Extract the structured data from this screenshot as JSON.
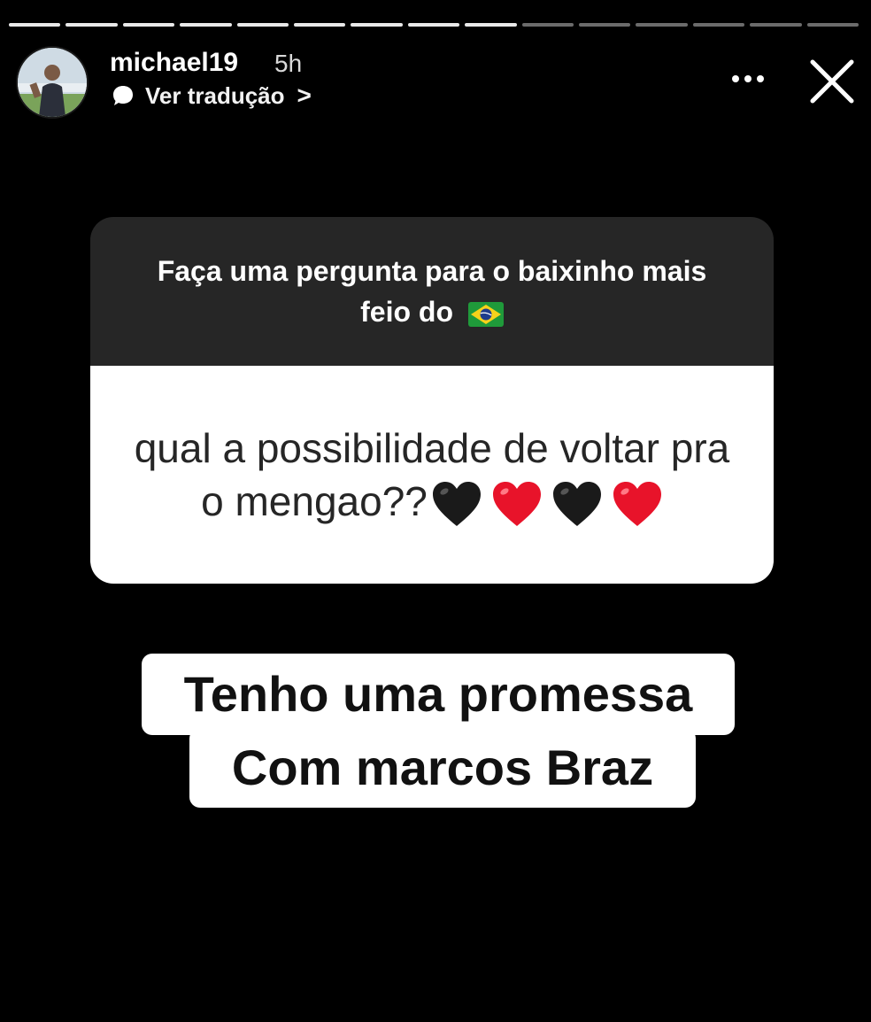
{
  "story": {
    "progress": {
      "segments": 15,
      "completed": 9
    },
    "header": {
      "username": "michael19",
      "time": "5h",
      "translate_label": "Ver tradução",
      "translate_chevron": ">"
    },
    "question": {
      "prompt": "Faça uma pergunta para o baixinho mais feio do",
      "prompt_emoji": "brazil-flag",
      "answer": "qual a possibilidade de voltar pra o mengao??",
      "answer_emojis": [
        "black-heart",
        "red-heart",
        "black-heart",
        "red-heart"
      ]
    },
    "reply": {
      "line1": "Tenho uma promessa",
      "line2": "Com marcos Braz"
    }
  },
  "colors": {
    "background": "#000000",
    "card_top": "#262626",
    "card_bottom": "#ffffff",
    "heart_red": "#e8132a",
    "heart_black": "#1a1a1a"
  }
}
